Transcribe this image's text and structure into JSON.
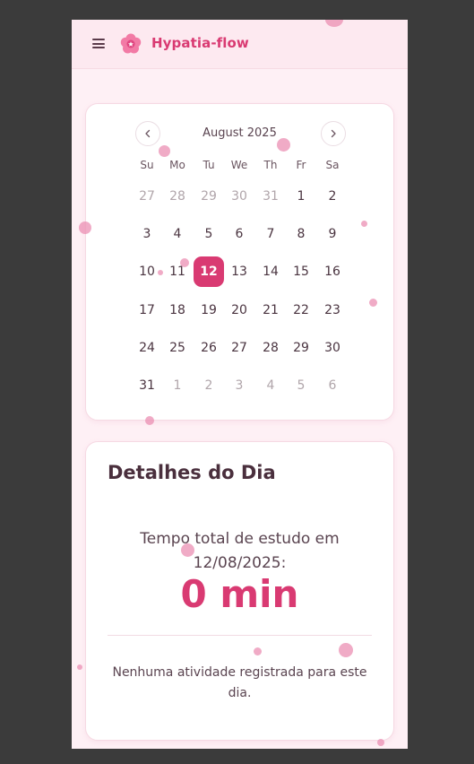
{
  "app": {
    "title": "Hypatia-flow",
    "brand_color": "#d93a72",
    "icon": "flower-icon",
    "menu_icon": "hamburger-menu-icon"
  },
  "calendar": {
    "month_label": "August 2025",
    "prev_icon": "chevron-left-icon",
    "next_icon": "chevron-right-icon",
    "weekdays": [
      "Su",
      "Mo",
      "Tu",
      "We",
      "Th",
      "Fr",
      "Sa"
    ],
    "selected_day": "12",
    "weeks": [
      [
        {
          "d": "27",
          "m": true
        },
        {
          "d": "28",
          "m": true
        },
        {
          "d": "29",
          "m": true
        },
        {
          "d": "30",
          "m": true
        },
        {
          "d": "31",
          "m": true
        },
        {
          "d": "1"
        },
        {
          "d": "2"
        }
      ],
      [
        {
          "d": "3"
        },
        {
          "d": "4"
        },
        {
          "d": "5"
        },
        {
          "d": "6"
        },
        {
          "d": "7"
        },
        {
          "d": "8"
        },
        {
          "d": "9"
        }
      ],
      [
        {
          "d": "10"
        },
        {
          "d": "11"
        },
        {
          "d": "12",
          "s": true
        },
        {
          "d": "13"
        },
        {
          "d": "14"
        },
        {
          "d": "15"
        },
        {
          "d": "16"
        }
      ],
      [
        {
          "d": "17"
        },
        {
          "d": "18"
        },
        {
          "d": "19"
        },
        {
          "d": "20"
        },
        {
          "d": "21"
        },
        {
          "d": "22"
        },
        {
          "d": "23"
        }
      ],
      [
        {
          "d": "24"
        },
        {
          "d": "25"
        },
        {
          "d": "26"
        },
        {
          "d": "27"
        },
        {
          "d": "28"
        },
        {
          "d": "29"
        },
        {
          "d": "30"
        }
      ],
      [
        {
          "d": "31"
        },
        {
          "d": "1",
          "m": true
        },
        {
          "d": "2",
          "m": true
        },
        {
          "d": "3",
          "m": true
        },
        {
          "d": "4",
          "m": true
        },
        {
          "d": "5",
          "m": true
        },
        {
          "d": "6",
          "m": true
        }
      ]
    ]
  },
  "details": {
    "title": "Detalhes do Dia",
    "total_label_line1": "Tempo total de estudo em",
    "total_label_line2": "12/08/2025:",
    "total_value": "0 min",
    "empty_message_line1": "Nenhuma atividade registrada para este",
    "empty_message_line2": "dia."
  }
}
